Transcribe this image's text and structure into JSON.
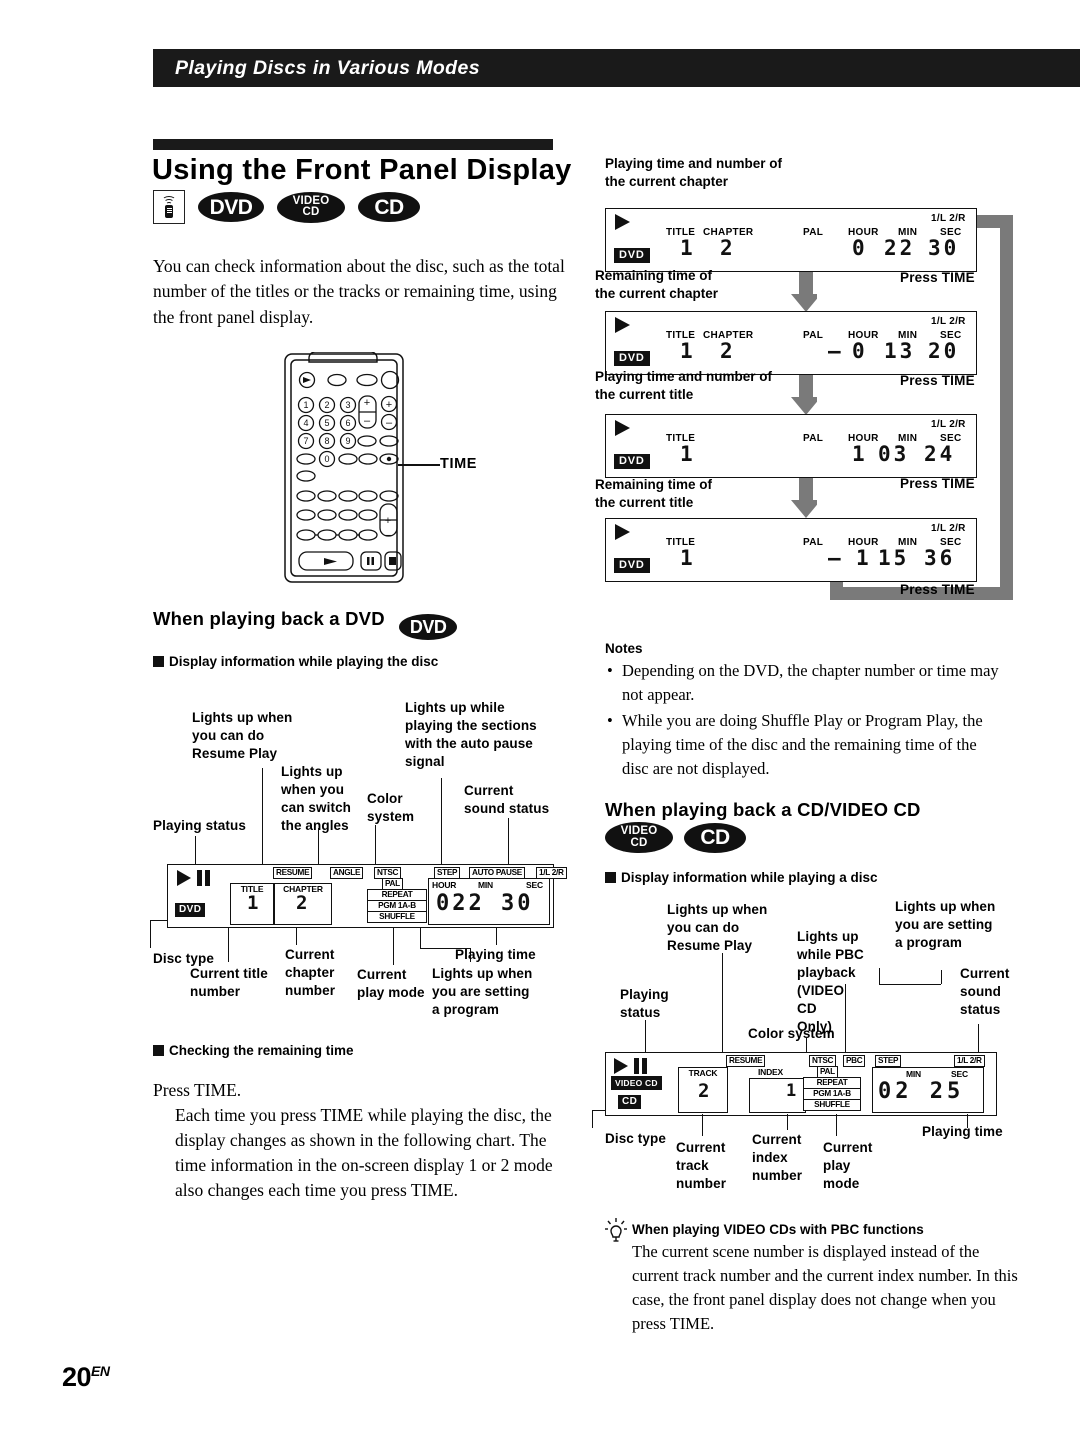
{
  "running_head": "Playing Discs in Various Modes",
  "section": {
    "title": "Using the Front Panel Display",
    "badges": [
      {
        "name": "remote-badge",
        "label": ""
      },
      {
        "name": "dvd-badge",
        "label": "DVD"
      },
      {
        "name": "video-cd-badge",
        "label": "VIDEO",
        "label2": "CD"
      },
      {
        "name": "cd-badge",
        "label": "CD"
      }
    ],
    "intro": "You can check information about the disc, such as the total number of the titles or the tracks or remaining time, using the front panel display."
  },
  "remote": {
    "callout_label": "TIME",
    "keys": [
      "1",
      "2",
      "3",
      "4",
      "5",
      "6",
      "7",
      "8",
      "9",
      "0"
    ]
  },
  "dvd_section": {
    "heading": "When playing back a DVD",
    "badge": "DVD",
    "sub1": "Display information while playing the disc",
    "sub2": "Checking the remaining time",
    "callouts": {
      "playing_status": "Playing status",
      "resume": "Lights up when\nyou can do\nResume Play",
      "angle": "Lights up\nwhen you\ncan switch\nthe angles",
      "color_system": "Color\nsystem",
      "auto_pause": "Lights up while\nplaying the sections\nwith the auto pause\nsignal",
      "sound_status": "Current\nsound status",
      "disc_type": "Disc type",
      "title_number": "Current title\nnumber",
      "chapter_number": "Current\nchapter\nnumber",
      "play_mode": "Current\nplay mode",
      "step": "Lights up when\nyou are setting\na program",
      "playing_time": "Playing time"
    },
    "panel": {
      "disc_type": "DVD",
      "indicators": [
        "RESUME",
        "ANGLE",
        "NTSC",
        "PAL",
        "REPEAT",
        "PGM 1A-B",
        "SHUFFLE",
        "STEP",
        "AUTO PAUSE",
        "1/L 2/R"
      ],
      "title_label": "TITLE",
      "chapter_label": "CHAPTER",
      "hour_label": "HOUR",
      "min_label": "MIN",
      "sec_label": "SEC",
      "title_value": "1",
      "chapter_value": "2",
      "time_value": "022 30"
    },
    "press_time_heading": "Press TIME.",
    "press_time_body": "Each time you press TIME while playing the disc, the display changes as shown in the following chart.  The time information in the on-screen display 1 or 2 mode also changes each time you press TIME."
  },
  "flow": {
    "press_label": "Press TIME",
    "steps": [
      {
        "caption": "Playing time and number of\nthe current chapter",
        "disc_type": "DVD",
        "labels": {
          "title": "TITLE",
          "chapter": "CHAPTER",
          "pal": "PAL",
          "hour": "HOUR",
          "min": "MIN",
          "sec": "SEC",
          "sound": "1/L 2/R"
        },
        "title_value": "1",
        "chapter_value": "2",
        "minus": false,
        "hour": "0",
        "min": "22",
        "sec": "30"
      },
      {
        "caption": "Remaining time of\nthe current chapter",
        "disc_type": "DVD",
        "labels": {
          "title": "TITLE",
          "chapter": "CHAPTER",
          "pal": "PAL",
          "hour": "HOUR",
          "min": "MIN",
          "sec": "SEC",
          "sound": "1/L 2/R"
        },
        "title_value": "1",
        "chapter_value": "2",
        "minus": true,
        "hour": "0",
        "min": "13",
        "sec": "20"
      },
      {
        "caption": "Playing time and number of\nthe current title",
        "disc_type": "DVD",
        "labels": {
          "title": "TITLE",
          "chapter": "",
          "pal": "PAL",
          "hour": "HOUR",
          "min": "MIN",
          "sec": "SEC",
          "sound": "1/L 2/R"
        },
        "title_value": "1",
        "chapter_value": "",
        "minus": false,
        "hour": "1",
        "min": "03",
        "sec": "24"
      },
      {
        "caption": "Remaining time of\nthe current title",
        "disc_type": "DVD",
        "labels": {
          "title": "TITLE",
          "chapter": "",
          "pal": "PAL",
          "hour": "HOUR",
          "min": "MIN",
          "sec": "SEC",
          "sound": "1/L 2/R"
        },
        "title_value": "1",
        "chapter_value": "",
        "minus": true,
        "hour": "1",
        "min": "15",
        "sec": "36"
      }
    ],
    "final_press_label": "Press TIME"
  },
  "notes": {
    "heading": "Notes",
    "items": [
      "Depending on the DVD, the chapter number or time may not appear.",
      "While you are doing Shuffle Play or Program Play, the playing time of the disc and the remaining time of the disc are not displayed."
    ]
  },
  "cd_section": {
    "heading": "When playing back a CD/VIDEO CD",
    "badges": [
      "VIDEO CD",
      "CD"
    ],
    "sub1": "Display information while playing a disc",
    "callouts": {
      "playing_status": "Playing\nstatus",
      "resume": "Lights up when\nyou can do\nResume Play",
      "pbc": "Lights up\nwhile PBC\nplayback\n(VIDEO CD\nOnly)",
      "color_system": "Color system",
      "step": "Lights up when\nyou are setting\na program",
      "sound_status": "Current\nsound\nstatus",
      "disc_type": "Disc type",
      "track_number": "Current\ntrack\nnumber",
      "index_number": "Current\nindex\nnumber",
      "play_mode": "Current\nplay\nmode",
      "playing_time": "Playing time"
    },
    "panel": {
      "disc_type_1": "VIDEO CD",
      "disc_type_2": "CD",
      "indicators": [
        "RESUME",
        "NTSC",
        "PAL",
        "PBC",
        "STEP",
        "REPEAT",
        "PGM 1A-B",
        "SHUFFLE",
        "1/L 2/R"
      ],
      "track_label": "TRACK",
      "index_label": "INDEX",
      "min_label": "MIN",
      "sec_label": "SEC",
      "track_value": "2",
      "index_value": "1",
      "time_value": "02 25"
    }
  },
  "tip": {
    "heading": "When playing VIDEO CDs with PBC functions",
    "body": "The current scene number is displayed instead of the current track number and the current index number.  In this case, the front panel display does not change when you press TIME."
  },
  "folio": {
    "number": "20",
    "suffix": "EN"
  }
}
